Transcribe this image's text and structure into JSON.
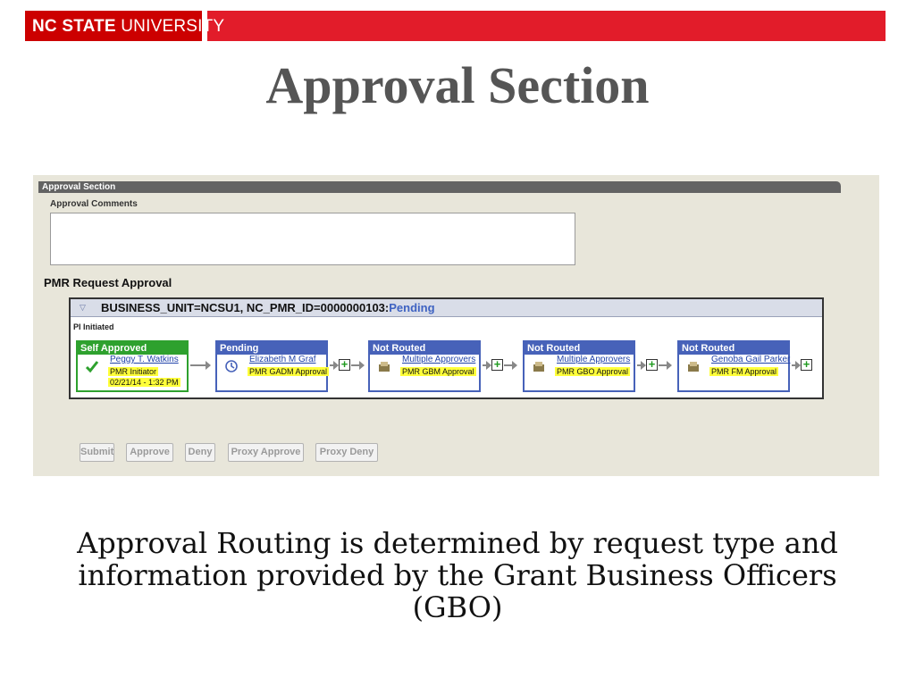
{
  "header": {
    "brand_bold": "NC STATE",
    "brand_regular": "UNIVERSITY",
    "slide_title": "Approval Section",
    "brand_color": "#e21c2a"
  },
  "approval_section": {
    "section_title": "Approval Section",
    "comments_label": "Approval Comments",
    "comments_value": "",
    "request_title": "PMR Request Approval",
    "routing": {
      "id_text": "BUSINESS_UNIT=NCSU1, NC_PMR_ID=0000000103:",
      "status_text": "Pending",
      "pi_label": "PI Initiated",
      "steps": [
        {
          "status": "Self Approved",
          "approver": "Peggy T. Watkins",
          "role": "PMR Initiator",
          "date": "02/21/14 - 1:32 PM",
          "icon": "checkmark-icon"
        },
        {
          "status": "Pending",
          "approver": "Elizabeth M Graf",
          "role": "PMR GADM Approval",
          "icon": "clock-icon"
        },
        {
          "status": "Not Routed",
          "approver": "Multiple Approvers",
          "role": "PMR GBM Approval",
          "icon": "inbox-icon"
        },
        {
          "status": "Not Routed",
          "approver": "Multiple Approvers",
          "role": "PMR GBO Approval",
          "icon": "inbox-icon"
        },
        {
          "status": "Not Routed",
          "approver": "Genoba Gail Parker",
          "role": "PMR FM Approval",
          "icon": "inbox-icon"
        }
      ]
    },
    "buttons": {
      "submit": "Submit",
      "approve": "Approve",
      "deny": "Deny",
      "proxy_approve": "Proxy Approve",
      "proxy_deny": "Proxy Deny"
    }
  },
  "footer": {
    "caption": "Approval Routing is determined by request type and information provided by the Grant Business Officers (GBO)"
  }
}
